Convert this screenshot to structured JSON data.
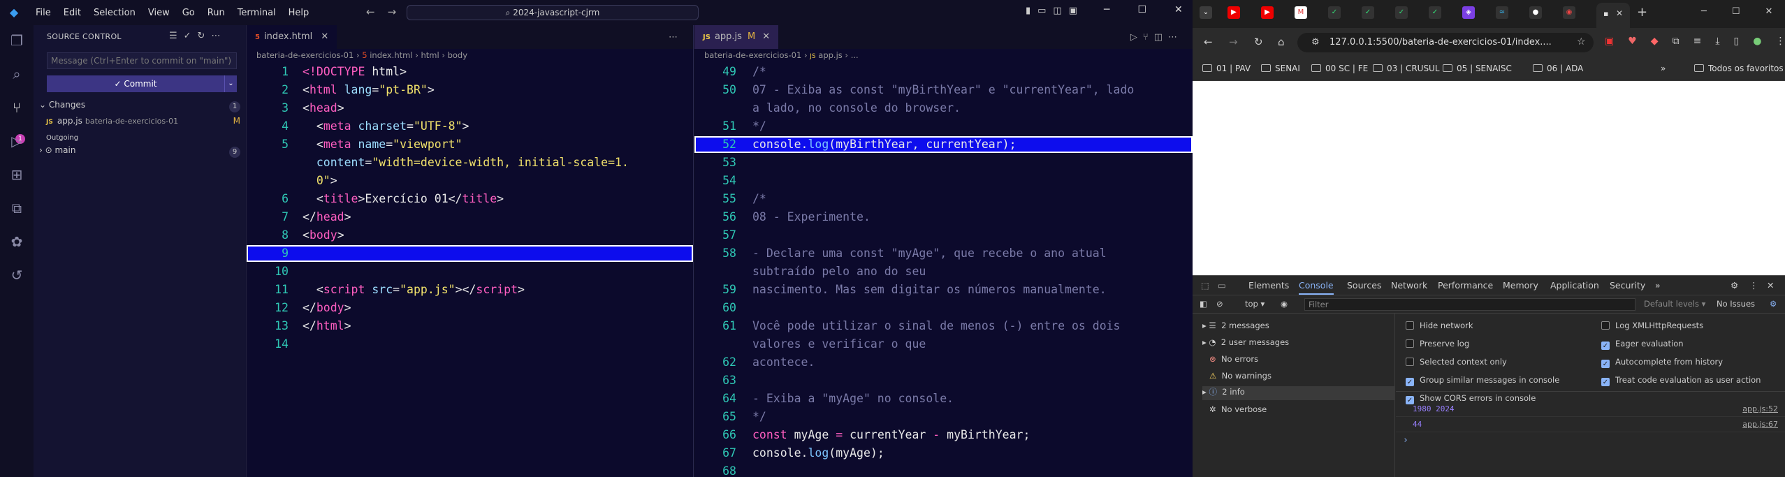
{
  "vscode": {
    "menu": [
      "File",
      "Edit",
      "Selection",
      "View",
      "Go",
      "Run",
      "Terminal",
      "Help"
    ],
    "search": "2024-javascript-cjrm",
    "scm_badge": "1"
  },
  "scm": {
    "title": "SOURCE CONTROL",
    "placeholder": "Message (Ctrl+Enter to commit on \"main\")",
    "commit": "Commit",
    "changes_label": "Changes",
    "changes_count": "1",
    "file": {
      "name": "app.js",
      "path": "bateria-de-exercicios-01",
      "status": "M"
    },
    "outgoing": "Outgoing",
    "branch": "main",
    "outgoing_count": "9"
  },
  "editor_left": {
    "tab": "index.html",
    "crumb": [
      "bateria-de-exercicios-01",
      "index.html",
      "html",
      "body"
    ],
    "highlight_line": "9",
    "lines": [
      {
        "n": "1",
        "h": [
          [
            "<!",
            "tg"
          ],
          [
            "DOCTYPE",
            "tg"
          ],
          [
            " html>",
            "vr"
          ]
        ]
      },
      {
        "n": "2",
        "h": [
          [
            "<",
            "vr"
          ],
          [
            "html",
            "tg"
          ],
          [
            " lang",
            "at"
          ],
          [
            "=",
            "vr"
          ],
          [
            "\"pt-BR\"",
            "st"
          ],
          [
            ">",
            "vr"
          ]
        ]
      },
      {
        "n": "3",
        "h": [
          [
            "<",
            "vr"
          ],
          [
            "head",
            "tg"
          ],
          [
            ">",
            "vr"
          ]
        ]
      },
      {
        "n": "4",
        "h": [
          [
            "  <",
            "vr"
          ],
          [
            "meta",
            "tg"
          ],
          [
            " charset",
            "at"
          ],
          [
            "=",
            "vr"
          ],
          [
            "\"UTF-8\"",
            "st"
          ],
          [
            ">",
            "vr"
          ]
        ]
      },
      {
        "n": "5",
        "h": [
          [
            "  <",
            "vr"
          ],
          [
            "meta",
            "tg"
          ],
          [
            " name",
            "at"
          ],
          [
            "=",
            "vr"
          ],
          [
            "\"viewport\"",
            "st"
          ]
        ]
      },
      {
        "n": "",
        "h": [
          [
            "  content",
            "at"
          ],
          [
            "=",
            "vr"
          ],
          [
            "\"width=device-width, initial-scale=1.",
            "st"
          ]
        ]
      },
      {
        "n": "",
        "h": [
          [
            "  0\"",
            "st"
          ],
          [
            ">",
            "vr"
          ]
        ]
      },
      {
        "n": "6",
        "h": [
          [
            "  <",
            "vr"
          ],
          [
            "title",
            "tg"
          ],
          [
            ">Exercício 01</",
            "vr"
          ],
          [
            "title",
            "tg"
          ],
          [
            ">",
            "vr"
          ]
        ]
      },
      {
        "n": "7",
        "h": [
          [
            "</",
            "vr"
          ],
          [
            "head",
            "tg"
          ],
          [
            ">",
            "vr"
          ]
        ]
      },
      {
        "n": "8",
        "h": [
          [
            "<",
            "vr"
          ],
          [
            "body",
            "tg"
          ],
          [
            ">",
            "vr"
          ]
        ]
      },
      {
        "n": "9",
        "h": [
          [
            "",
            "vr"
          ]
        ]
      },
      {
        "n": "10",
        "h": [
          [
            "",
            "vr"
          ]
        ]
      },
      {
        "n": "11",
        "h": [
          [
            "  <",
            "vr"
          ],
          [
            "script",
            "tg"
          ],
          [
            " src",
            "at"
          ],
          [
            "=",
            "vr"
          ],
          [
            "\"app.js\"",
            "st"
          ],
          [
            "></",
            "vr"
          ],
          [
            "script",
            "tg"
          ],
          [
            ">",
            "vr"
          ]
        ]
      },
      {
        "n": "12",
        "h": [
          [
            "</",
            "vr"
          ],
          [
            "body",
            "tg"
          ],
          [
            ">",
            "vr"
          ]
        ]
      },
      {
        "n": "13",
        "h": [
          [
            "</",
            "vr"
          ],
          [
            "html",
            "tg"
          ],
          [
            ">",
            "vr"
          ]
        ]
      },
      {
        "n": "14",
        "h": [
          [
            "",
            "vr"
          ]
        ]
      }
    ]
  },
  "editor_right": {
    "tab": "app.js",
    "tab_status": "M",
    "crumb": [
      "bateria-de-exercicios-01",
      "app.js",
      "..."
    ],
    "highlight_line": "52",
    "lines": [
      {
        "n": "49",
        "h": [
          [
            "/*",
            "cm"
          ]
        ]
      },
      {
        "n": "50",
        "h": [
          [
            "07 - Exiba as const \"myBirthYear\" e \"currentYear\", lado",
            "cm"
          ]
        ]
      },
      {
        "n": "",
        "h": [
          [
            "a lado, no console do browser.",
            "cm"
          ]
        ]
      },
      {
        "n": "51",
        "h": [
          [
            "*/",
            "cm"
          ]
        ]
      },
      {
        "n": "52",
        "h": [
          [
            "console",
            ""
          ],
          [
            ".",
            "vr"
          ],
          [
            "log",
            "fn"
          ],
          [
            "(myBirthYear, currentYear);",
            "vr"
          ]
        ]
      },
      {
        "n": "53",
        "h": [
          [
            "",
            "vr"
          ]
        ]
      },
      {
        "n": "54",
        "h": [
          [
            "",
            "vr"
          ]
        ]
      },
      {
        "n": "55",
        "h": [
          [
            "/*",
            "cm"
          ]
        ]
      },
      {
        "n": "56",
        "h": [
          [
            "08 - Experimente.",
            "cm"
          ]
        ]
      },
      {
        "n": "57",
        "h": [
          [
            "",
            "vr"
          ]
        ]
      },
      {
        "n": "58",
        "h": [
          [
            "- Declare uma const \"myAge\", que recebe o ano atual",
            "cm"
          ]
        ]
      },
      {
        "n": "",
        "h": [
          [
            "subtraído pelo ano do seu",
            "cm"
          ]
        ]
      },
      {
        "n": "59",
        "h": [
          [
            "nascimento. Mas sem digitar os números manualmente.",
            "cm"
          ]
        ]
      },
      {
        "n": "60",
        "h": [
          [
            "",
            "vr"
          ]
        ]
      },
      {
        "n": "61",
        "h": [
          [
            "Você pode utilizar o sinal de menos (-) entre os dois",
            "cm"
          ]
        ]
      },
      {
        "n": "",
        "h": [
          [
            "valores e verificar o que",
            "cm"
          ]
        ]
      },
      {
        "n": "62",
        "h": [
          [
            "acontece.",
            "cm"
          ]
        ]
      },
      {
        "n": "63",
        "h": [
          [
            "",
            "vr"
          ]
        ]
      },
      {
        "n": "64",
        "h": [
          [
            "- Exiba a \"myAge\" no console.",
            "cm"
          ]
        ]
      },
      {
        "n": "65",
        "h": [
          [
            "*/",
            "cm"
          ]
        ]
      },
      {
        "n": "66",
        "h": [
          [
            "const",
            "kw"
          ],
          [
            " myAge ",
            "vr"
          ],
          [
            "=",
            "kw"
          ],
          [
            " currentYear ",
            "vr"
          ],
          [
            "-",
            "kw"
          ],
          [
            " myBirthYear;",
            "vr"
          ]
        ]
      },
      {
        "n": "67",
        "h": [
          [
            "console",
            ""
          ],
          [
            ".",
            "vr"
          ],
          [
            "log",
            "fn"
          ],
          [
            "(myAge);",
            "vr"
          ]
        ]
      },
      {
        "n": "68",
        "h": [
          [
            "",
            "vr"
          ]
        ]
      }
    ]
  },
  "chrome": {
    "url": "127.0.0.1:5500/bateria-de-exercicios-01/index....",
    "bookmarks": [
      "01 | PAV",
      "SENAI",
      "00 SC | FE",
      "03 | CRUSUL",
      "05 | SENAISC",
      "06 | ADA"
    ],
    "all_bookmarks": "Todos os favoritos"
  },
  "devtools": {
    "tabs": [
      "Elements",
      "Console",
      "Sources",
      "Network",
      "Performance",
      "Memory",
      "Application",
      "Security"
    ],
    "context": "top",
    "filter_placeholder": "Filter",
    "levels": "Default levels",
    "issues": "No Issues",
    "sidebar": [
      "2 messages",
      "2 user messages",
      "No errors",
      "No warnings",
      "2 info",
      "No verbose"
    ],
    "settings": [
      {
        "label": "Hide network",
        "checked": false
      },
      {
        "label": "Preserve log",
        "checked": false
      },
      {
        "label": "Selected context only",
        "checked": false
      },
      {
        "label": "Group similar messages in console",
        "checked": true
      },
      {
        "label": "Show CORS errors in console",
        "checked": true
      },
      {
        "label": "Log XMLHttpRequests",
        "checked": false
      },
      {
        "label": "Eager evaluation",
        "checked": true
      },
      {
        "label": "Autocomplete from history",
        "checked": true
      },
      {
        "label": "Treat code evaluation as user action",
        "checked": true
      }
    ],
    "logs": [
      {
        "text": "1980 2024",
        "source": "app.js:52"
      },
      {
        "text": "44",
        "source": "app.js:67"
      }
    ]
  }
}
